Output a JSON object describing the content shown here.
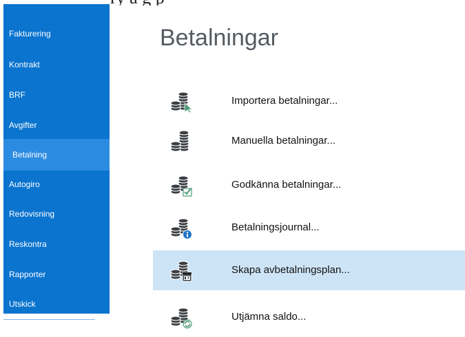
{
  "top_cut_text": "ry   a   g     p",
  "sidebar": {
    "items": [
      {
        "label": "Fakturering"
      },
      {
        "label": "Kontrakt"
      },
      {
        "label": "BRF"
      },
      {
        "label": "Avgifter"
      },
      {
        "label": "Betalning",
        "active": true
      },
      {
        "label": "Autogiro"
      },
      {
        "label": "Redovisning"
      },
      {
        "label": "Reskontra"
      },
      {
        "label": "Rapporter"
      },
      {
        "label": "Utskick"
      }
    ]
  },
  "main": {
    "title": "Betalningar",
    "actions": [
      {
        "label": "Importera betalningar...",
        "icon": "import-payments-icon"
      },
      {
        "label": "Manuella betalningar...",
        "icon": "manual-payments-icon"
      },
      {
        "label": "Godkänna betalningar...",
        "icon": "approve-payments-icon"
      },
      {
        "label": "Betalningsjournal...",
        "icon": "payment-journal-icon"
      },
      {
        "label": "Skapa avbetalningsplan...",
        "icon": "installment-plan-icon",
        "highlighted": true
      },
      {
        "label": "Utjämna saldo...",
        "icon": "balance-equalize-icon"
      }
    ]
  },
  "colors": {
    "sidebar_bg": "#0a74cf",
    "sidebar_active": "#2b8be0",
    "highlight": "#cde4f7",
    "coin": "#3a3e42",
    "accent_green": "#4e9a78",
    "accent_blue": "#1e73c8"
  }
}
